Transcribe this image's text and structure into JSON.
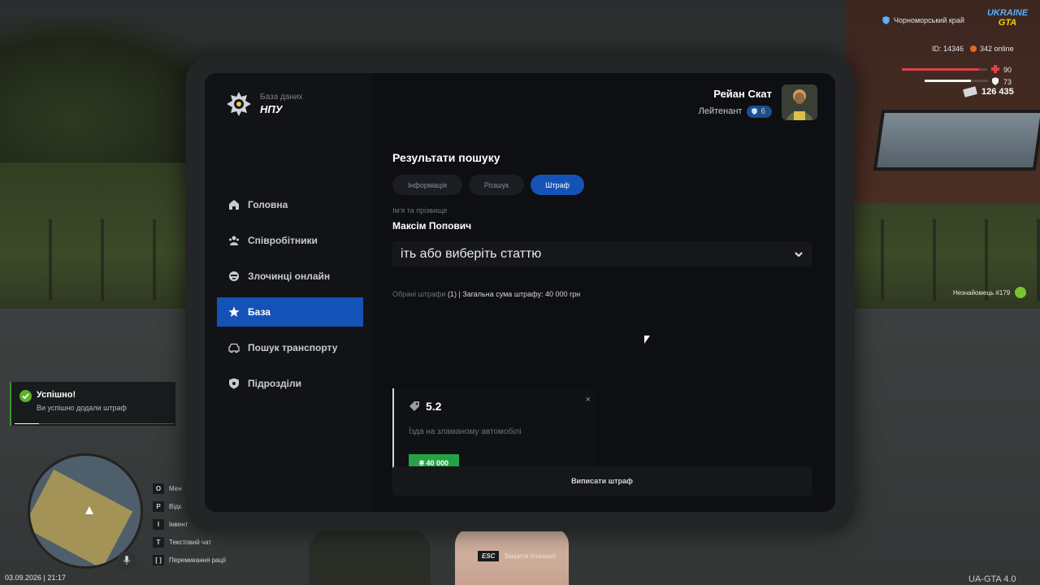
{
  "hud": {
    "region": "Чорноморський край",
    "logo_top": "UKRAINE",
    "logo_bottom": "GTA",
    "id_label": "ID: 14346",
    "online": "342 online",
    "health": "90",
    "armor": "73",
    "health_level": 0.9,
    "armor_level": 0.73,
    "money": "126 435",
    "npc_label": "Незнайомець #179",
    "datetime": "03.09.2026 | 21:17",
    "version": "UA-GTA 4.0",
    "esc_key": "ESC",
    "esc_label": "Закрити планшет",
    "keys": [
      {
        "key": "O",
        "label": "Мен"
      },
      {
        "key": "P",
        "label": "Відк"
      },
      {
        "key": "I",
        "label": "Інвент"
      },
      {
        "key": "T",
        "label": "Текстовий чат"
      },
      {
        "key": "[  ]",
        "label": "Перемикання рації"
      }
    ]
  },
  "notification": {
    "title": "Успішно!",
    "text": "Ви успішно додали штраф"
  },
  "tablet": {
    "logo_sub": "База даних",
    "logo_main": "НПУ",
    "user_name": "Рейан Скат",
    "user_rank": "Лейтенант",
    "rank_level": "6",
    "nav": [
      {
        "label": "Головна",
        "icon": "home-icon"
      },
      {
        "label": "Співробітники",
        "icon": "users-icon"
      },
      {
        "label": "Злочинці онлайн",
        "icon": "criminal-icon"
      },
      {
        "label": "База",
        "icon": "star-icon",
        "active": true
      },
      {
        "label": "Пошук транспорту",
        "icon": "car-icon"
      },
      {
        "label": "Підрозділи",
        "icon": "shield-icon"
      }
    ],
    "title": "Результати пошуку",
    "tabs": [
      {
        "label": "Інформація"
      },
      {
        "label": "Розшук"
      },
      {
        "label": "Штраф",
        "active": true
      }
    ],
    "name_label": "Ім'я та прізвище",
    "name_value": "Максім Попович",
    "select_placeholder": "іть або виберіть статтю",
    "summary_prefix": "Обрані штрафи",
    "summary_rest": "(1) | Загальна сума штрафу: 40 000 грн",
    "fine": {
      "code": "5.2",
      "close": "×",
      "description": "Їзда на зламаному автомобілі",
      "amount": "₴ 40 000"
    },
    "submit_label": "Виписати штраф"
  }
}
